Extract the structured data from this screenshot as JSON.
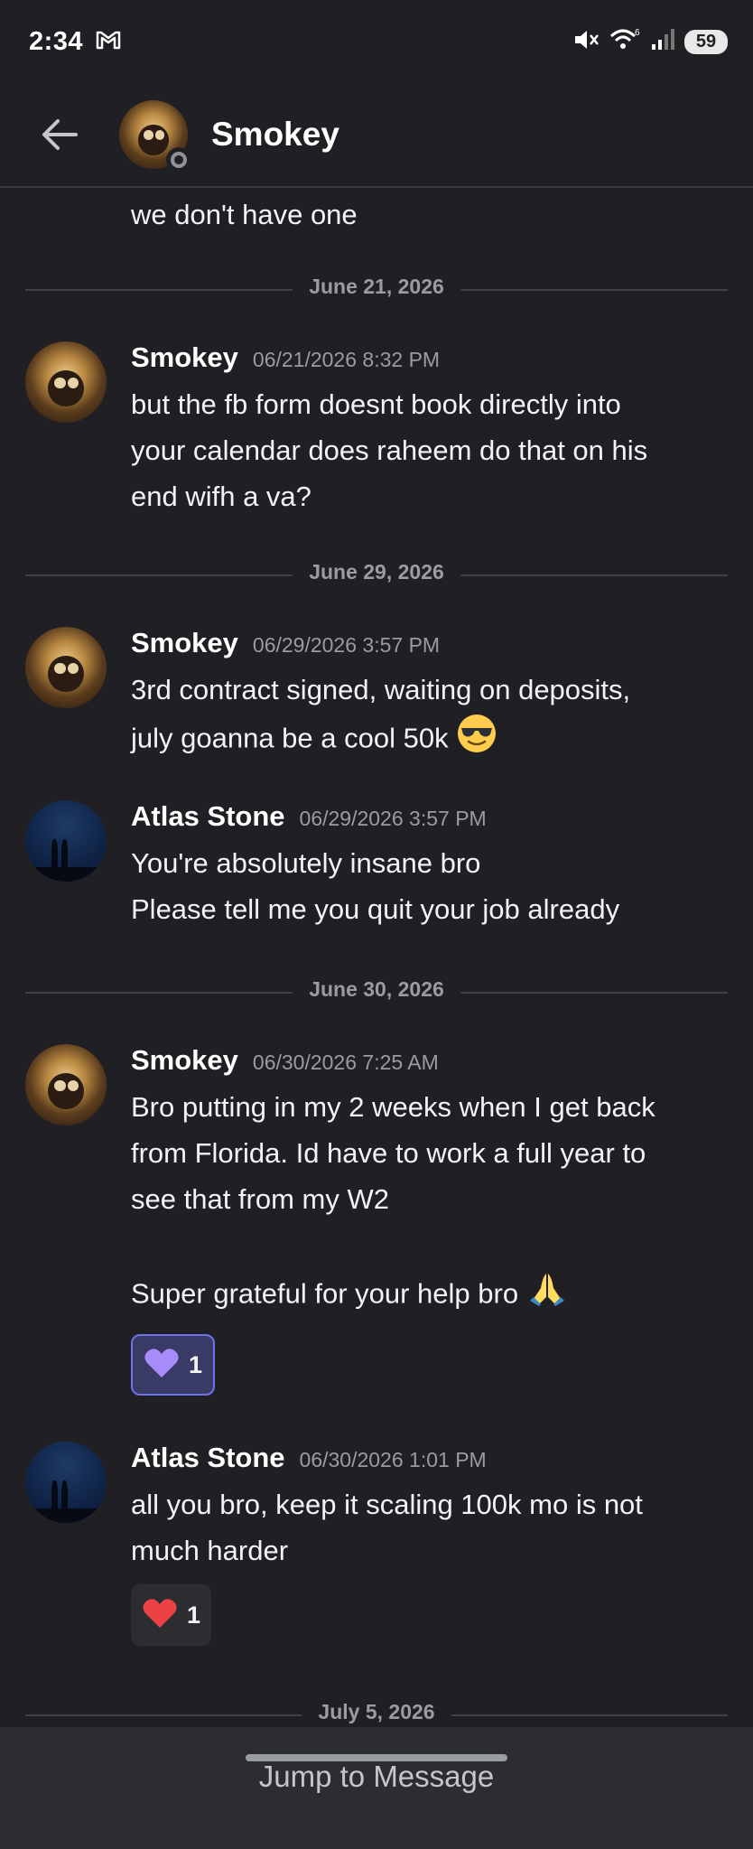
{
  "status_bar": {
    "time": "2:34",
    "battery": "59",
    "icons": [
      "gmail-icon",
      "mute-icon",
      "wifi-icon",
      "signal-icon",
      "battery-icon"
    ]
  },
  "header": {
    "contact_name": "Smokey",
    "back_icon": "back-arrow-icon"
  },
  "orphan_message": "we don't have one",
  "dividers": [
    "June 21, 2026",
    "June 29, 2026",
    "June 30, 2026",
    "July 5, 2026"
  ],
  "messages": [
    {
      "author": "Smokey",
      "time": "06/21/2026 8:32 PM",
      "lines": [
        "but the fb form doesnt book directly into",
        "your calendar does raheem do that on his",
        "end wifh a va?"
      ]
    },
    {
      "author": "Smokey",
      "time": "06/29/2026 3:57 PM",
      "lines": [
        "3rd contract signed, waiting on deposits,",
        "july goanna be a cool 50k"
      ],
      "emoji": "sunglasses-face-emoji"
    },
    {
      "author": "Atlas Stone",
      "time": "06/29/2026 3:57 PM",
      "lines": [
        "You're absolutely insane bro",
        "Please tell me you quit your job already"
      ]
    },
    {
      "author": "Smokey",
      "time": "06/30/2026 7:25 AM",
      "lines": [
        "Bro putting in my 2 weeks when I get back",
        "from Florida. Id have to work a full year to",
        "see that from my W2",
        "",
        "Super grateful for your help bro"
      ],
      "emoji": "folded-hands-emoji",
      "reaction": {
        "icon": "purple-heart-emoji",
        "count": "1"
      }
    },
    {
      "author": "Atlas Stone",
      "time": "06/30/2026 1:01 PM",
      "lines": [
        "all you bro, keep it scaling 100k mo is not",
        "much harder"
      ],
      "reaction": {
        "icon": "red-heart-emoji",
        "count": "1"
      }
    }
  ],
  "jump_button": "Jump to Message",
  "colors": {
    "background": "#1f1f24",
    "divider": "#3f4147",
    "muted_text": "#9a9ca3",
    "reaction_active": "#6f73e8",
    "purple_heart": "#a78bfa",
    "red_heart": "#ed4245"
  }
}
